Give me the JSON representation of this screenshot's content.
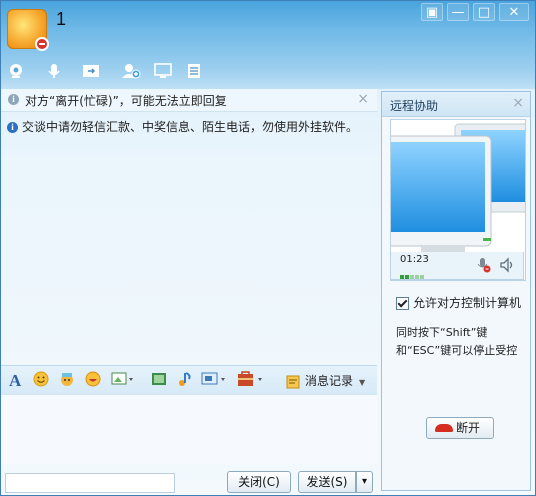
{
  "contact": {
    "name": "1"
  },
  "window_controls": {
    "mode_glyph": "▣",
    "minimize_glyph": "—",
    "maximize_glyph": "□",
    "close_glyph": "✕"
  },
  "toolbar": {
    "icons": [
      "video-call-icon",
      "voice-call-icon",
      "file-transfer-icon",
      "add-contact-icon",
      "remote-desktop-icon",
      "app-menu-icon"
    ]
  },
  "notice": {
    "text": "对方“离开(忙碌)”，可能无法立即回复",
    "close_glyph": "×"
  },
  "messages": [
    {
      "text": "交谈中请勿轻信汇款、中奖信息、陌生电话，勿使用外挂软件。"
    }
  ],
  "chat_toolbar": {
    "icons": [
      "font-icon",
      "emoji-icon",
      "gift-icon",
      "jokes-icon",
      "screenshot-icon",
      "image-icon",
      "music-icon",
      "screen-capture-icon",
      "app-box-icon"
    ],
    "history_label": "消息记录"
  },
  "buttons": {
    "close_label": "关闭(C)",
    "send_label": "发送(S)",
    "send_dropdown": "▾"
  },
  "remote_panel": {
    "title": "远程协助",
    "close_glyph": "×",
    "timer": "01:23",
    "allow_control_label": "允许对方控制计算机",
    "allow_control_checked": true,
    "hint": "同时按下“Shift”键和“ESC”键可以停止受控",
    "disconnect_label": "断开"
  },
  "colors": {
    "title_bar": "#4aa4dd",
    "panel_border": "#9dc3df",
    "hangup": "#d42e21"
  }
}
